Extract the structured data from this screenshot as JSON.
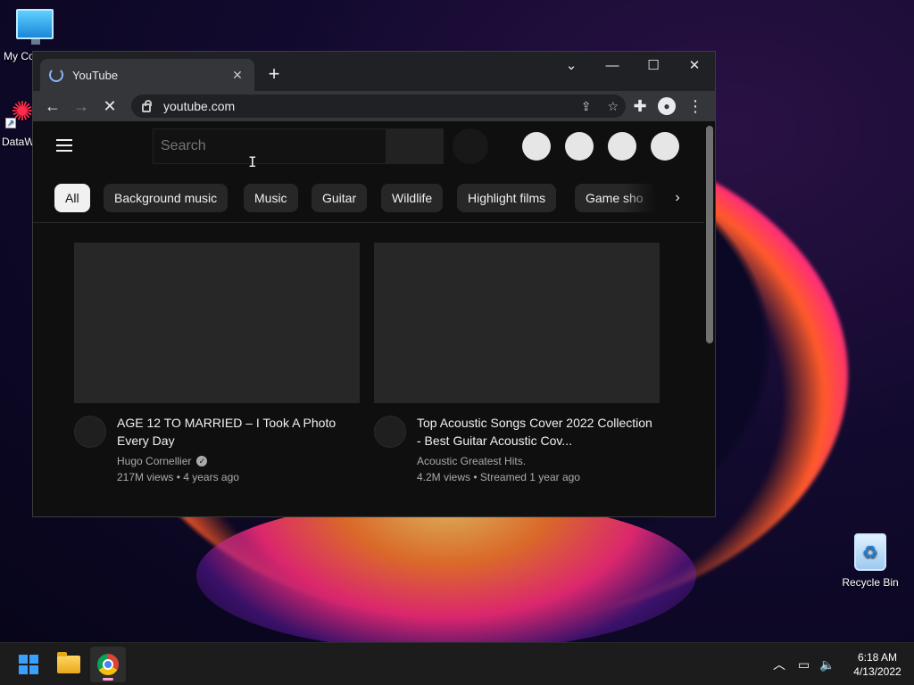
{
  "desktop": {
    "icons": [
      {
        "label": "My Co",
        "icon": "monitor-icon"
      },
      {
        "label": "DataW",
        "icon": "datawrapper-shortcut-icon"
      },
      {
        "label": "Recycle Bin",
        "icon": "recycle-bin-icon"
      }
    ]
  },
  "browser": {
    "tab_title": "YouTube",
    "new_tab": "+",
    "url": "youtube.com",
    "controls": {
      "tab_search": "⌄",
      "minimize": "—",
      "maximize": "☐",
      "close": "✕"
    }
  },
  "youtube": {
    "search_placeholder": "Search",
    "chips": [
      "All",
      "Background music",
      "Music",
      "Guitar",
      "Wildlife",
      "Highlight films",
      "Game sho"
    ],
    "active_chip": "All",
    "videos": [
      {
        "title": "AGE 12 TO MARRIED – I Took A Photo Every Day",
        "channel": "Hugo Cornellier",
        "verified": true,
        "views": "217M views",
        "age": "4 years ago"
      },
      {
        "title": "Top Acoustic Songs Cover 2022 Collection - Best Guitar Acoustic Cov...",
        "channel": "Acoustic Greatest Hits.",
        "verified": false,
        "views": "4.2M views",
        "age": "Streamed 1 year ago"
      }
    ]
  },
  "taskbar": {
    "time": "6:18 AM",
    "date": "4/13/2022"
  },
  "colors": {
    "yt_bg": "#0f0f0f",
    "chip_bg": "#272727",
    "chip_active_bg": "#f1f1f1",
    "chrome_toolbar": "#35363a",
    "taskbar_bg": "#1c1c1c"
  }
}
